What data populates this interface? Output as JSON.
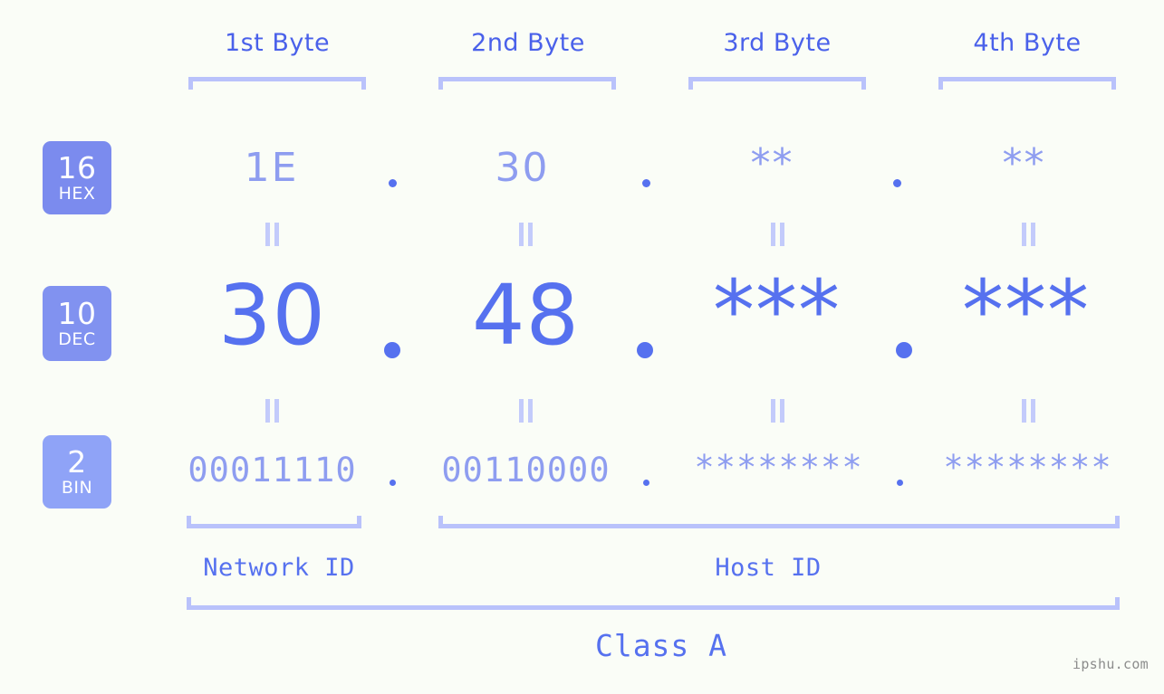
{
  "page": {
    "background": "#fafdf7",
    "watermark": "ipshu.com"
  },
  "colors": {
    "accent_strong": "#5671ef",
    "accent_mid": "#8e9df0",
    "accent_light": "#b9c2fb",
    "header_text": "#4a61ea",
    "badge_hex": "#7b8bee",
    "badge_dec": "#8192f0",
    "badge_bin": "#8fa3f7",
    "badge_text": "#ffffff",
    "watermark_text": "#8c8c8c"
  },
  "byte_headers": [
    {
      "label": "1st Byte"
    },
    {
      "label": "2nd Byte"
    },
    {
      "label": "3rd Byte"
    },
    {
      "label": "4th Byte"
    }
  ],
  "rows": [
    {
      "badge": {
        "num": "16",
        "name": "HEX",
        "color": "#7b8bee"
      },
      "values": [
        "1E",
        "30",
        "**",
        "**"
      ],
      "separator": "."
    },
    {
      "badge": {
        "num": "10",
        "name": "DEC",
        "color": "#8192f0"
      },
      "values": [
        "30",
        "48",
        "***",
        "***"
      ],
      "separator": "."
    },
    {
      "badge": {
        "num": "2",
        "name": "BIN",
        "color": "#8fa3f7"
      },
      "values": [
        "00011110",
        "00110000",
        "********",
        "********"
      ],
      "separator": "."
    }
  ],
  "equals_symbol": "=",
  "footer": {
    "network_id_label": "Network ID",
    "host_id_label": "Host ID",
    "class_label": "Class A"
  }
}
